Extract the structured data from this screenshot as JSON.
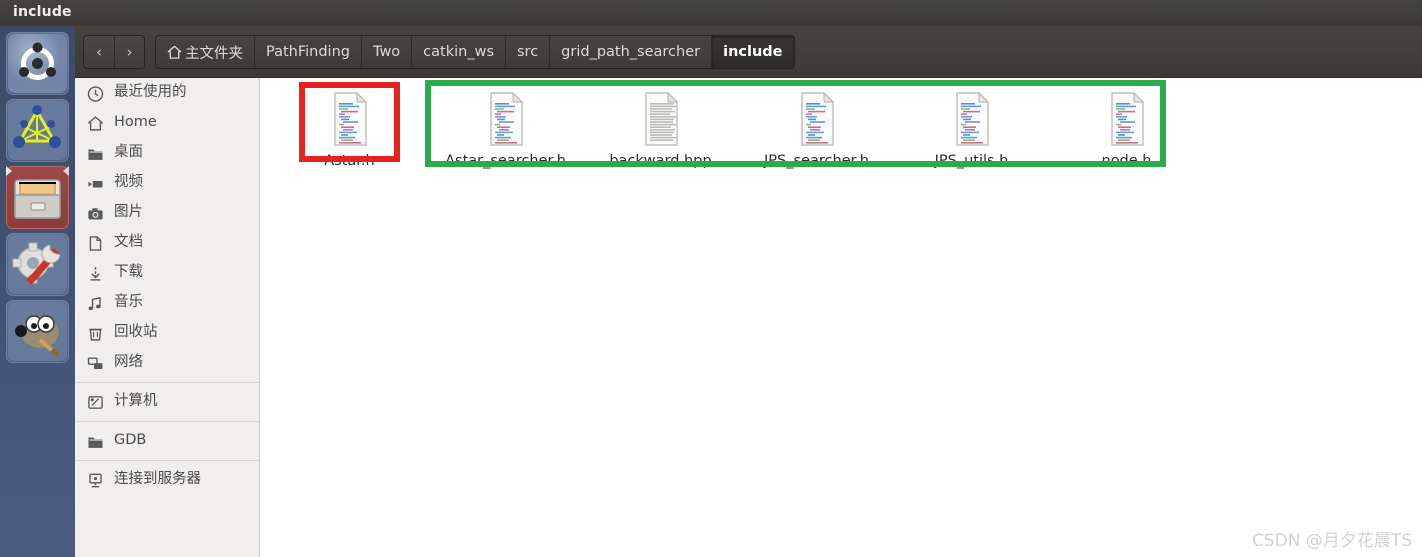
{
  "window": {
    "title": "include"
  },
  "launcher": {
    "items": [
      {
        "name": "ubuntu-dash",
        "icon": "ubuntu-logo-icon",
        "selected": false
      },
      {
        "name": "app-yellow-network",
        "icon": "network-graph-icon",
        "selected": false
      },
      {
        "name": "files-nautilus",
        "icon": "file-cabinet-icon",
        "selected": true
      },
      {
        "name": "system-settings",
        "icon": "gear-wrench-icon",
        "selected": false
      },
      {
        "name": "gimp",
        "icon": "gimp-wilber-icon",
        "selected": false
      }
    ]
  },
  "toolbar": {
    "back_label": "‹",
    "forward_label": "›",
    "breadcrumbs": [
      {
        "label": "主文件夹",
        "icon": "home-icon",
        "active": false
      },
      {
        "label": "PathFinding",
        "icon": "",
        "active": false
      },
      {
        "label": "Two",
        "icon": "",
        "active": false
      },
      {
        "label": "catkin_ws",
        "icon": "",
        "active": false
      },
      {
        "label": "src",
        "icon": "",
        "active": false
      },
      {
        "label": "grid_path_searcher",
        "icon": "",
        "active": false
      },
      {
        "label": "include",
        "icon": "",
        "active": true
      }
    ]
  },
  "sidebar": {
    "groups": [
      {
        "items": [
          {
            "label": "最近使用的",
            "icon": "clock-icon"
          },
          {
            "label": "Home",
            "icon": "home-icon"
          },
          {
            "label": "桌面",
            "icon": "folder-icon"
          },
          {
            "label": "视频",
            "icon": "video-icon"
          },
          {
            "label": "图片",
            "icon": "camera-icon"
          },
          {
            "label": "文档",
            "icon": "document-icon"
          },
          {
            "label": "下载",
            "icon": "download-icon"
          },
          {
            "label": "音乐",
            "icon": "music-note-icon"
          },
          {
            "label": "回收站",
            "icon": "trash-icon"
          },
          {
            "label": "网络",
            "icon": "network-icon"
          }
        ]
      },
      {
        "items": [
          {
            "label": "计算机",
            "icon": "computer-icon"
          }
        ]
      },
      {
        "items": [
          {
            "label": "GDB",
            "icon": "folder-icon"
          }
        ]
      },
      {
        "items": [
          {
            "label": "连接到服务器",
            "icon": "server-connect-icon"
          }
        ]
      }
    ]
  },
  "content": {
    "files": [
      {
        "name": "Astar.h",
        "icon": "code-file-icon",
        "style": "code"
      },
      {
        "name": "Astar_searcher.h",
        "icon": "code-file-icon",
        "style": "code"
      },
      {
        "name": "backward.hpp",
        "icon": "text-file-icon",
        "style": "plain"
      },
      {
        "name": "JPS_searcher.h",
        "icon": "code-file-icon",
        "style": "code"
      },
      {
        "name": "JPS_utils.h",
        "icon": "code-file-icon",
        "style": "code"
      },
      {
        "name": "node.h",
        "icon": "code-file-icon",
        "style": "code"
      }
    ]
  },
  "annotations": {
    "red_box": {
      "label": "red-highlight",
      "color": "#e8221f"
    },
    "green_box": {
      "label": "green-highlight",
      "color": "#2bab4c"
    }
  },
  "watermark": {
    "text": "CSDN @月夕花晨TS"
  },
  "colors": {
    "titlebar": "#3b3a36",
    "toolbar": "#3c3a36",
    "sidebar_bg": "#f1efed",
    "content_bg": "#ffffff",
    "launcher_bg": "#41527a",
    "accent_red": "#e8221f",
    "accent_green": "#2bab4c"
  }
}
